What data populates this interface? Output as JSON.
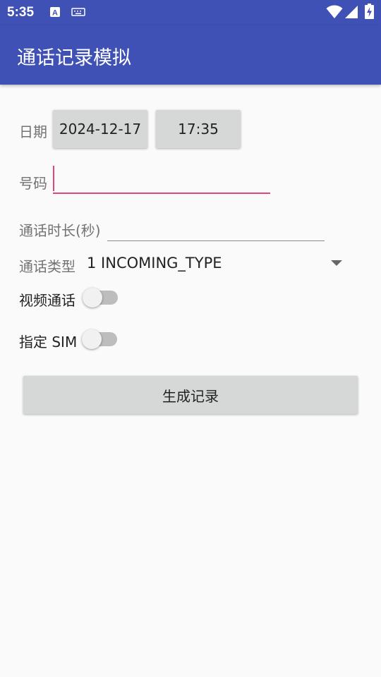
{
  "status_bar": {
    "time": "5:35"
  },
  "app_bar": {
    "title": "通话记录模拟"
  },
  "form": {
    "date_label": "日期",
    "date_value": "2024-12-17",
    "time_value": "17:35",
    "number_label": "号码",
    "number_value": "",
    "duration_label": "通话时长(秒)",
    "duration_value": "",
    "type_label": "通话类型",
    "type_selected": "1 INCOMING_TYPE",
    "video_label": "视频通话",
    "video_on": false,
    "sim_label": "指定 SIM",
    "sim_on": false,
    "submit_label": "生成记录"
  },
  "colors": {
    "primary": "#3f51b5",
    "accent": "#e0457b",
    "background": "#fafafa"
  }
}
